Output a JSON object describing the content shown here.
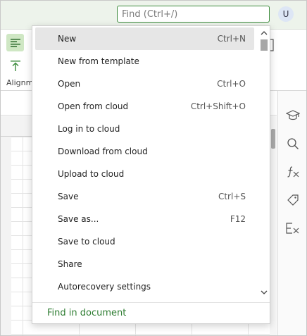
{
  "titlebar": {
    "search": {
      "placeholder": "Find (Ctrl+/)",
      "value": ""
    },
    "avatar_initial": "U"
  },
  "ribbon": {
    "alignment_group_label": "Alignm"
  },
  "file_menu": {
    "items": [
      {
        "label": "New",
        "shortcut": "Ctrl+N",
        "active": true
      },
      {
        "label": "New from template",
        "shortcut": ""
      },
      {
        "label": "Open",
        "shortcut": "Ctrl+O"
      },
      {
        "label": "Open from cloud",
        "shortcut": "Ctrl+Shift+O"
      },
      {
        "label": "Log in to cloud",
        "shortcut": ""
      },
      {
        "label": "Download from cloud",
        "shortcut": ""
      },
      {
        "label": "Upload to cloud",
        "shortcut": ""
      },
      {
        "label": "Save",
        "shortcut": "Ctrl+S"
      },
      {
        "label": "Save as...",
        "shortcut": "F12"
      },
      {
        "label": "Save to cloud",
        "shortcut": ""
      },
      {
        "label": "Share",
        "shortcut": ""
      },
      {
        "label": "Autorecovery settings",
        "shortcut": ""
      }
    ],
    "footer_link": "Find in document"
  },
  "side_panel": {
    "icons": [
      "graduation-cap-icon",
      "search-icon",
      "function-icon",
      "tag-icon",
      "clear-formula-icon"
    ]
  },
  "colors": {
    "accent": "#3c8b3c",
    "link": "#2e7d32",
    "titlebar_bg": "#edf3eb",
    "selected_bg": "#cfe7c4",
    "menu_hover": "#e6e6e6"
  }
}
